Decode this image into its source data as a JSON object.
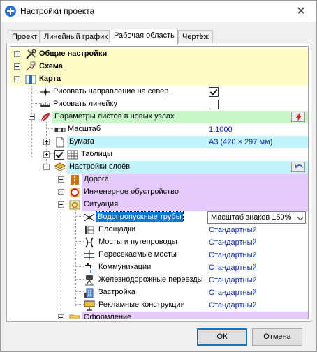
{
  "window": {
    "title": "Настройки проекта"
  },
  "tabs": [
    {
      "label": "Проект"
    },
    {
      "label": "Линейный график"
    },
    {
      "label": "Рабочая область"
    },
    {
      "label": "Чертёж"
    }
  ],
  "tree": {
    "general": {
      "label": "Общие настройки"
    },
    "scheme": {
      "label": "Схема"
    },
    "map": {
      "label": "Карта"
    },
    "north": {
      "label": "Рисовать направление на север",
      "checked": true
    },
    "ruler": {
      "label": "Рисовать линейку",
      "checked": false
    },
    "sheet_params": {
      "label": "Параметры листов в новых узлах"
    },
    "scale": {
      "label": "Масштаб",
      "value": "1:1000"
    },
    "paper": {
      "label": "Бумага",
      "value": "А3 (420 × 297 мм)"
    },
    "tables": {
      "label": "Таблицы",
      "checked": true
    },
    "layers": {
      "label": "Настройки слоёв"
    },
    "road": {
      "label": "Дорога"
    },
    "engineering": {
      "label": "Инженерное обустройство"
    },
    "situation": {
      "label": "Ситуация"
    },
    "culverts": {
      "label": "Водопропускные трубы",
      "value": "Масштаб знаков 150%"
    },
    "platforms": {
      "label": "Площадки",
      "value": "Стандартный"
    },
    "bridges": {
      "label": "Мосты и путепроводы",
      "value": "Стандартный"
    },
    "crossing_bridges": {
      "label": "Пересекаемые мосты",
      "value": "Стандартный"
    },
    "communications": {
      "label": "Коммуникации",
      "value": "Стандартный"
    },
    "railway": {
      "label": "Железнодорожные переезды",
      "value": "Стандартный"
    },
    "buildings": {
      "label": "Застройка",
      "value": "Стандартный"
    },
    "advertising": {
      "label": "Рекламные конструкции",
      "value": "Стандартный"
    },
    "design": {
      "label": "Оформление"
    }
  },
  "buttons": {
    "ok": "ОК",
    "cancel": "Отмена"
  },
  "colors": {
    "yellow_row": "#fefdc8",
    "green_row": "#c9f7c9",
    "cyan_row": "#c4f4fb",
    "purple_row": "#e5cbf9",
    "value_text": "#0a2a9c",
    "selection": "#0078d7"
  }
}
